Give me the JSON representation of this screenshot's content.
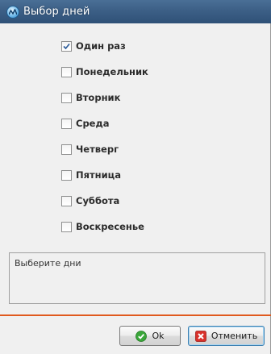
{
  "window": {
    "title": "Выбор дней",
    "icon": "app-icon"
  },
  "days": [
    {
      "label": "Один раз",
      "checked": true
    },
    {
      "label": "Понедельник",
      "checked": false
    },
    {
      "label": "Вторник",
      "checked": false
    },
    {
      "label": "Среда",
      "checked": false
    },
    {
      "label": "Четверг",
      "checked": false
    },
    {
      "label": "Пятница",
      "checked": false
    },
    {
      "label": "Суббота",
      "checked": false
    },
    {
      "label": "Воскресенье",
      "checked": false
    }
  ],
  "hint": {
    "text": "Выберите дни"
  },
  "buttons": {
    "ok_label": "Ok",
    "ok_icon": "check-circle-icon",
    "cancel_label": "Отменить",
    "cancel_icon": "close-square-icon"
  },
  "colors": {
    "titlebar": "#3c5f86",
    "accent_divider": "#e05a1e",
    "ok_icon": "#3aa63a",
    "cancel_icon": "#d9302a"
  }
}
